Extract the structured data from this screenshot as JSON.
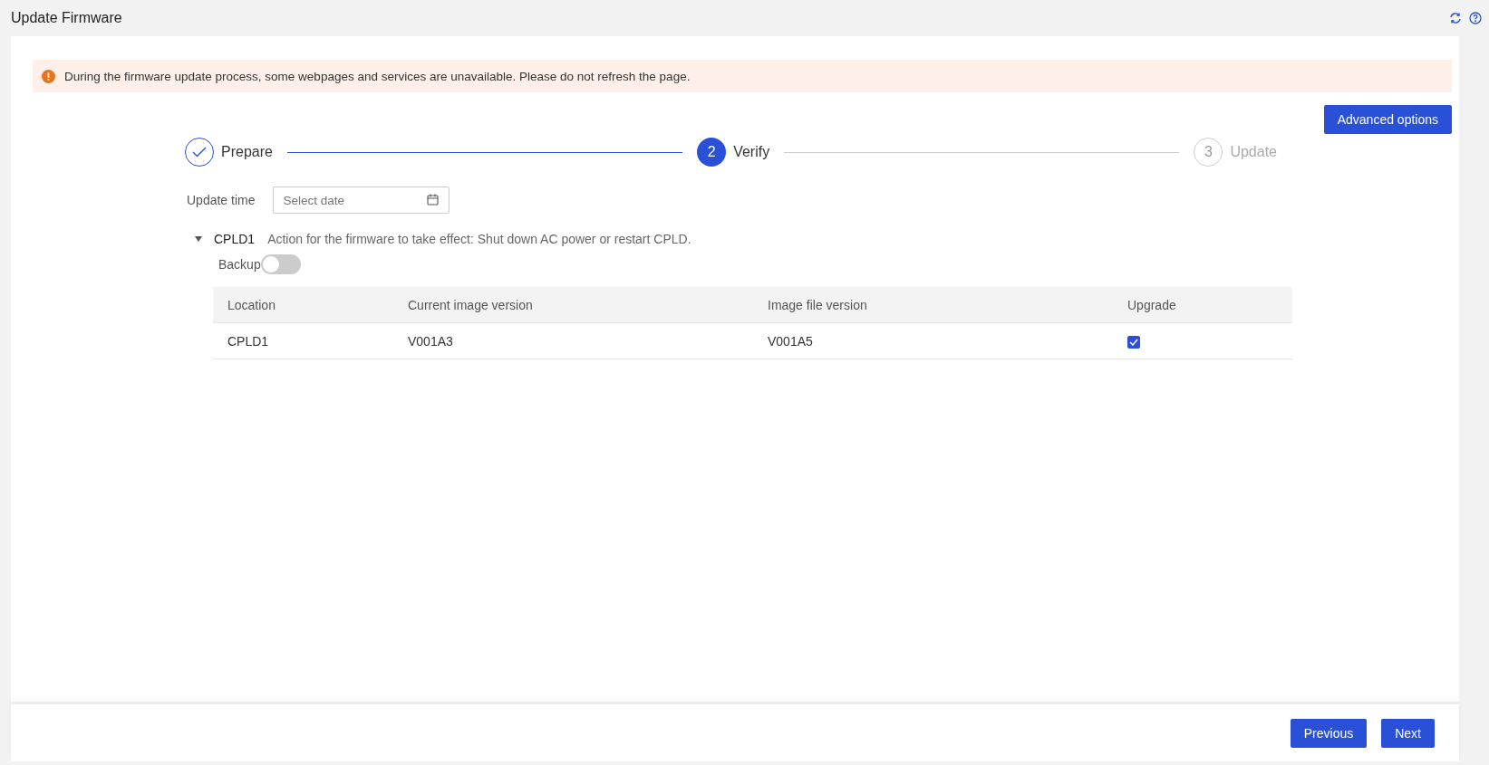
{
  "header": {
    "title": "Update Firmware"
  },
  "alert": {
    "text": "During the firmware update process, some webpages and services are unavailable. Please do not refresh the page."
  },
  "advanced_button": "Advanced options",
  "steps": [
    {
      "label": "Prepare",
      "completed": true,
      "selected": false
    },
    {
      "number": "2",
      "label": "Verify",
      "completed": false,
      "selected": true
    },
    {
      "number": "3",
      "label": "Update",
      "completed": false,
      "selected": false
    }
  ],
  "update_time": {
    "label": "Update time",
    "placeholder": "Select date"
  },
  "component": {
    "name": "CPLD1",
    "expanded": true,
    "note": "Action for the firmware to take effect: Shut down AC power or restart CPLD.",
    "backup_label": "Backup",
    "backup_on": false,
    "table": {
      "columns": [
        "Location",
        "Current image version",
        "Image file version",
        "Upgrade"
      ],
      "rows": [
        {
          "location": "CPLD1",
          "current": "V001A3",
          "file": "V001A5",
          "upgrade": true
        }
      ]
    }
  },
  "footer": {
    "buttons": [
      "Previous",
      "Next"
    ]
  }
}
